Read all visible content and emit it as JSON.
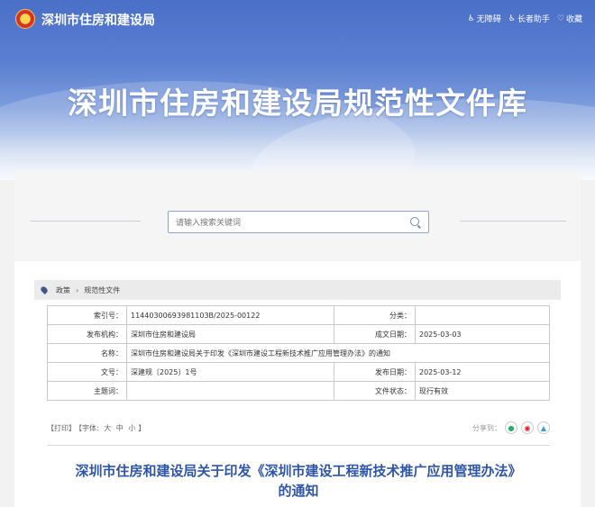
{
  "header": {
    "site_name": "深圳市住房和建设局",
    "links": [
      {
        "icon": "accessibility-icon",
        "label": "无障碍"
      },
      {
        "icon": "elder-assistant-icon",
        "label": "长者助手"
      },
      {
        "icon": "heart-icon",
        "label": "收藏"
      }
    ],
    "banner_title": "深圳市住房和建设局规范性文件库"
  },
  "search": {
    "placeholder": "请输入搜索关键词"
  },
  "breadcrumb": {
    "items": [
      "政策",
      "规范性文件"
    ]
  },
  "info_table": {
    "rows": [
      {
        "k1": "索引号：",
        "v1": "11440300693981103B/2025-00122",
        "k2": "分类：",
        "v2": ""
      },
      {
        "k1": "发布机构：",
        "v1": "深圳市住房和建设局",
        "k2": "成文日期：",
        "v2": "2025-03-03"
      },
      {
        "k1": "名称：",
        "v1": "深圳市住房和建设局关于印发《深圳市建设工程新技术推广应用管理办法》的通知",
        "k2": "",
        "v2": ""
      },
      {
        "k1": "文号：",
        "v1": "深建规〔2025〕1号",
        "k2": "发布日期：",
        "v2": "2025-03-12"
      },
      {
        "k1": "主题词：",
        "v1": "",
        "k2": "文件状态：",
        "v2": "现行有效"
      }
    ]
  },
  "tools": {
    "print": "【打印】",
    "font_label": "【字体:",
    "font_large": "大",
    "font_medium": "中",
    "font_small": "小",
    "font_close": "】",
    "share_label": "分享到："
  },
  "document": {
    "title_line1": "深圳市住房和建设局关于印发《深圳市建设工程新技术推广应用管理办法》",
    "title_line2": "的通知"
  },
  "colors": {
    "banner": "#5b80d2",
    "title_blue": "#2f56a6"
  }
}
